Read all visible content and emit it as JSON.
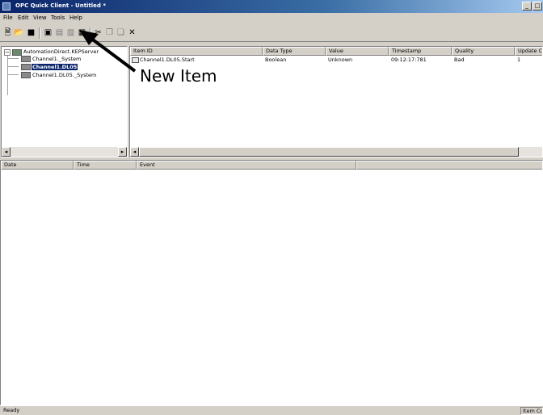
{
  "window": {
    "title": "OPC Quick Client - Untitled *",
    "controls": [
      "_",
      "□"
    ]
  },
  "menu": [
    "File",
    "Edit",
    "View",
    "Tools",
    "Help"
  ],
  "toolbar": {
    "icons": [
      "new-file-icon",
      "open-folder-icon",
      "save-icon",
      "new-server-connection-icon",
      "new-group-icon",
      "new-item-icon",
      "properties-icon",
      "cut-icon",
      "copy-icon",
      "paste-icon",
      "delete-icon"
    ]
  },
  "tree": {
    "root": "AutomationDirect.KEPServer",
    "children": [
      "Channel1._System",
      "Channel1.DL05",
      "Channel1.DL05._System"
    ],
    "selected_index": 1
  },
  "items_table": {
    "columns": [
      "Item ID",
      "Data Type",
      "Value",
      "Timestamp",
      "Quality",
      "Update C"
    ],
    "rows": [
      {
        "item_id": "Channel1.DL05.Start",
        "data_type": "Boolean",
        "value": "Unknown",
        "timestamp": "09:12:17:781",
        "quality": "Bad",
        "update_count": "1"
      }
    ]
  },
  "log_table": {
    "columns": [
      "Date",
      "Time",
      "Event"
    ]
  },
  "status": {
    "left": "Ready",
    "right": "Item Count:"
  },
  "annotation": {
    "label": "New Item"
  }
}
